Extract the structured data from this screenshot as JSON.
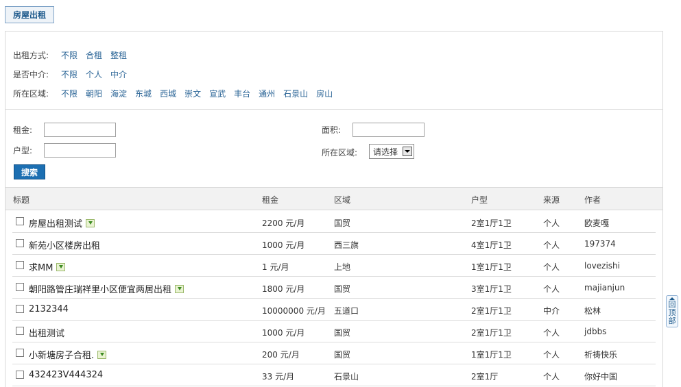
{
  "tab": {
    "label": "房屋出租"
  },
  "filters": {
    "rent_type": {
      "label": "出租方式:",
      "options": [
        "不限",
        "合租",
        "整租"
      ]
    },
    "agent": {
      "label": "是否中介:",
      "options": [
        "不限",
        "个人",
        "中介"
      ]
    },
    "district": {
      "label": "所在区域:",
      "options": [
        "不限",
        "朝阳",
        "海淀",
        "东城",
        "西城",
        "崇文",
        "宣武",
        "丰台",
        "通州",
        "石景山",
        "房山"
      ]
    }
  },
  "form": {
    "rent_label": "租金:",
    "area_label": "面积:",
    "layout_label": "户型:",
    "district_label": "所在区域:",
    "district_select": "请选择",
    "search_button": "搜索"
  },
  "table": {
    "headers": {
      "title": "标题",
      "rent": "租金",
      "area": "区域",
      "layout": "户型",
      "source": "来源",
      "author": "作者"
    },
    "rows": [
      {
        "title": "房屋出租测试",
        "has_pic": true,
        "rent": "2200 元/月",
        "area": "国贸",
        "layout": "2室1厅1卫",
        "source": "个人",
        "author": "欧麦嘎"
      },
      {
        "title": "新苑小区楼房出租",
        "has_pic": false,
        "rent": "1000 元/月",
        "area": "西三旗",
        "layout": "4室1厅1卫",
        "source": "个人",
        "author": "197374"
      },
      {
        "title": "求MM",
        "has_pic": true,
        "rent": "1 元/月",
        "area": "上地",
        "layout": "1室1厅1卫",
        "source": "个人",
        "author": "lovezishi"
      },
      {
        "title": "朝阳路管庄瑞祥里小区便宜两居出租",
        "has_pic": true,
        "rent": "1800 元/月",
        "area": "国贸",
        "layout": "3室1厅1卫",
        "source": "个人",
        "author": "majianjun"
      },
      {
        "title": "2132344",
        "has_pic": false,
        "rent": "10000000 元/月",
        "area": "五道口",
        "layout": "2室1厅1卫",
        "source": "中介",
        "author": "松林"
      },
      {
        "title": "出租测试",
        "has_pic": false,
        "rent": "1000 元/月",
        "area": "国贸",
        "layout": "2室1厅1卫",
        "source": "个人",
        "author": "jdbbs"
      },
      {
        "title": "小新塘房子合租.",
        "has_pic": true,
        "rent": "200 元/月",
        "area": "国贸",
        "layout": "1室1厅1卫",
        "source": "个人",
        "author": "祈祷快乐"
      },
      {
        "title": "432423V444324",
        "has_pic": false,
        "rent": "33 元/月",
        "area": "石景山",
        "layout": "2室1厅",
        "source": "个人",
        "author": "你好中国"
      }
    ]
  },
  "back_to_top": {
    "chars": [
      "回",
      "顶",
      "部"
    ]
  }
}
